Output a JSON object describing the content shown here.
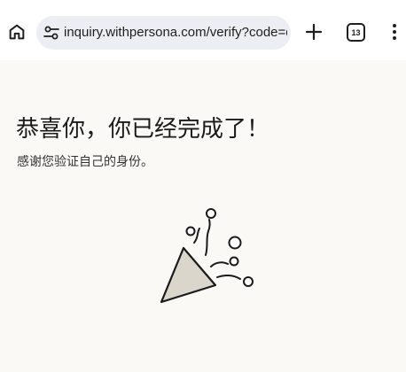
{
  "browser": {
    "url": "inquiry.withpersona.com/verify?code=qW",
    "tab_count": "13",
    "icons": {
      "home": "home-icon",
      "site_settings": "tune-icon",
      "new_tab": "plus-icon",
      "tabs": "tab-switcher-icon",
      "menu": "more-vert-icon"
    }
  },
  "page": {
    "heading": "恭喜你，你已经完成了！",
    "subtext": "感谢您验证自己的身份。",
    "illustration": "party-popper-icon"
  },
  "colors": {
    "page_background": "#faf9f6",
    "cone_fill": "#dbd6cc",
    "ink": "#1a1a1a"
  }
}
